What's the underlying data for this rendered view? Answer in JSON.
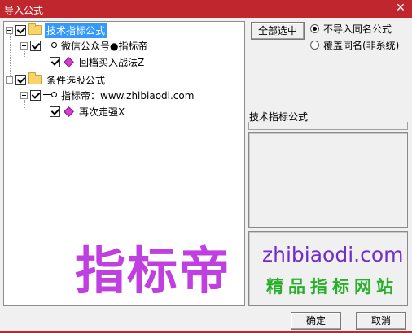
{
  "window": {
    "title": "导入公式",
    "close_glyph": "✕"
  },
  "tree": {
    "nodes": [
      {
        "label": "技术指标公式",
        "type": "folder",
        "checked": true,
        "selected": true
      },
      {
        "label": "微信公众号●指标帝",
        "type": "author",
        "checked": true
      },
      {
        "label": "回档买入战法Z",
        "type": "formula",
        "checked": true
      },
      {
        "label": "条件选股公式",
        "type": "folder",
        "checked": true
      },
      {
        "label": "指标帝：www.zhibiaodi.com",
        "type": "author",
        "checked": true
      },
      {
        "label": "再次走强X",
        "type": "formula",
        "checked": true
      }
    ]
  },
  "options": {
    "select_all_label": "全部选中",
    "radio_no_import_same": "不导入同名公式",
    "radio_overwrite_same": "覆盖同名(非系统)",
    "selected_radio": "不导入同名公式"
  },
  "info": {
    "type_label": "技术指标公式"
  },
  "watermark": {
    "big": "指标帝",
    "url": "zhibiaodi.com",
    "subtitle": "精品指标网站"
  },
  "buttons": {
    "ok": "确定",
    "cancel": "取消"
  },
  "colors": {
    "titlebar": "#c0262d",
    "selection": "#3399ff",
    "watermark_purple": "#c03fe0",
    "watermark_green": "#26b02a"
  }
}
